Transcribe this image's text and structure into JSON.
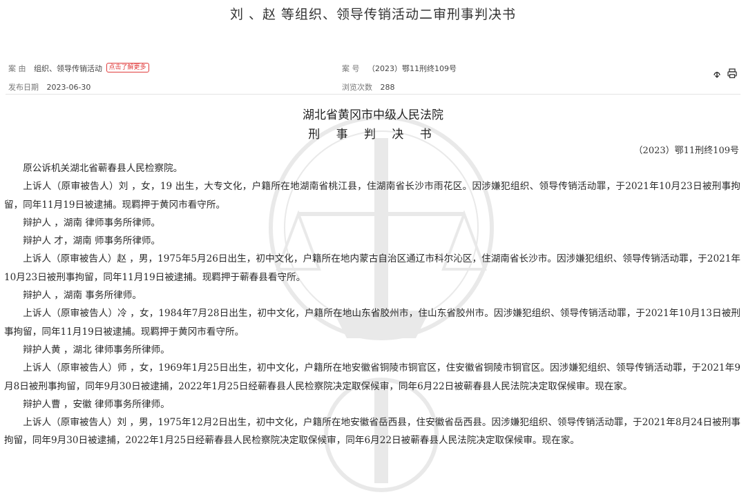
{
  "header": {
    "title": "刘 、赵 等组织、领导传销活动二审刑事判决书"
  },
  "meta": {
    "cause_label": "案 由",
    "cause_value": "组织、领导传销活动",
    "cause_tag": "点击了解更多",
    "case_label": "案 号",
    "case_value": "（2023）鄂11刑终109号",
    "date_label": "发布日期",
    "date_value": "2023-06-30",
    "views_label": "浏览次数",
    "views_value": "288"
  },
  "toolbar": {
    "download_icon": "download-icon",
    "print_icon": "print-icon"
  },
  "document": {
    "court": "湖北省黄冈市中级人民法院",
    "type": "刑 事 判 决 书",
    "case_no": "（2023）鄂11刑终109号",
    "paragraphs": [
      "原公诉机关湖北省蕲春县人民检察院。",
      "上诉人（原审被告人）刘 ，女，19 出生，大专文化，户籍所在地湖南省桃江县，住湖南省长沙市雨花区。因涉嫌犯组织、领导传销活动罪，于2021年10月23日被刑事拘留，同年11月19日被逮捕。现羁押于黄冈市看守所。",
      "辩护人 ，湖南 律师事务所律师。",
      "辩护人 才，湖南 师事务所律师。",
      "上诉人（原审被告人）赵 ，男，1975年5月26日出生，初中文化，户籍所在地内蒙古自治区通辽市科尔沁区，住湖南省长沙市。因涉嫌犯组织、领导传销活动罪，于2021年10月23日被刑事拘留，同年11月19日被逮捕。现羁押于蕲春县看守所。",
      "辩护人 ，湖南 事务所律师。",
      "上诉人（原审被告人）冷 ，女，1984年7月28日出生，初中文化，户籍所在地山东省胶州市，住山东省胶州市。因涉嫌犯组织、领导传销活动罪，于2021年10月13日被刑事拘留，同年11月19日被逮捕。现羁押于黄冈市看守所。",
      "辩护人黄 ，湖北 律师事务所律师。",
      "上诉人（原审被告人）师 ，女，1969年1月25日出生，初中文化，户籍所在地安徽省铜陵市铜官区，住安徽省铜陵市铜官区。因涉嫌犯组织、领导传销活动罪，于2021年9月8日被刑事拘留，同年9月30日被逮捕，2022年1月25日经蕲春县人民检察院决定取保候审，同年6月22日被蕲春县人民法院决定取保候审。现在家。",
      "辩护人曹 ，安徽 律师事务所律师。",
      "上诉人（原审被告人）刘 ，男，1975年12月2日出生，初中文化，户籍所在地安徽省岳西县，住安徽省岳西县。因涉嫌犯组织、领导传销活动罪，于2021年8月24日被刑事拘留，同年9月30日被逮捕，2022年1月25日经蕲春县人民检察院决定取保候审，同年6月22日被蕲春县人民法院决定取保候审。现在家。"
    ]
  }
}
